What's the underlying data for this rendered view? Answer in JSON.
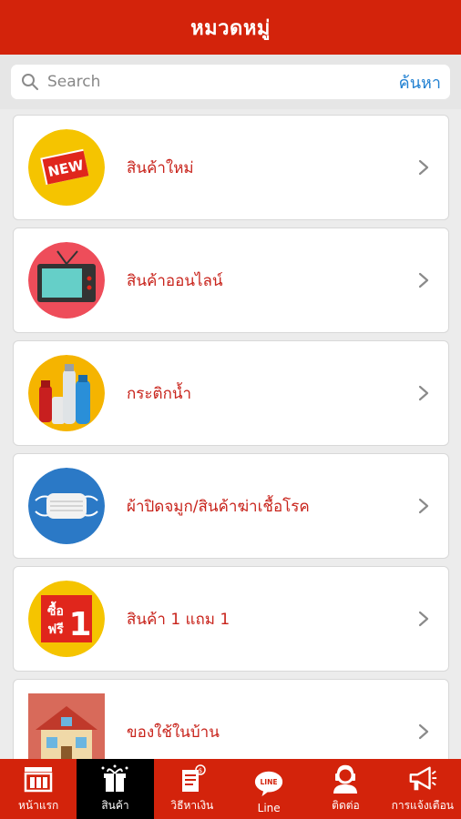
{
  "header": {
    "title": "หมวดหมู่"
  },
  "search": {
    "placeholder": "Search",
    "button_label": "ค้นหา"
  },
  "categories": [
    {
      "label": "สินค้าใหม่",
      "icon": "new-badge-icon",
      "badge_text": "NEW"
    },
    {
      "label": "สินค้าออนไลน์",
      "icon": "tv-icon"
    },
    {
      "label": "กระติกน้ำ",
      "icon": "water-bottle-icon"
    },
    {
      "label": "ผ้าปิดจมูก/สินค้าฆ่าเชื้อโรค",
      "icon": "face-mask-icon"
    },
    {
      "label": "สินค้า 1 แถม 1",
      "icon": "buy-one-get-one-icon",
      "badge_top": "ซื้อ",
      "badge_bottom": "ฟรี",
      "badge_num": "1"
    },
    {
      "label": "ของใช้ในบ้าน",
      "icon": "house-icon"
    }
  ],
  "nav": {
    "items": [
      {
        "label": "หน้าแรก",
        "icon": "storefront-icon",
        "active": false
      },
      {
        "label": "สินค้า",
        "icon": "products-icon",
        "active": true
      },
      {
        "label": "วิธีหาเงิน",
        "icon": "money-guide-icon",
        "active": false
      },
      {
        "label": "Line",
        "icon": "line-icon",
        "active": false
      },
      {
        "label": "ติดต่อ",
        "icon": "contact-icon",
        "active": false
      },
      {
        "label": "การแจ้งเตือน",
        "icon": "megaphone-icon",
        "active": false
      }
    ],
    "line_badge": "LINE"
  },
  "colors": {
    "primary": "#d3230b",
    "label": "#c8231b",
    "link": "#1e7fd1",
    "background": "#ececec"
  }
}
